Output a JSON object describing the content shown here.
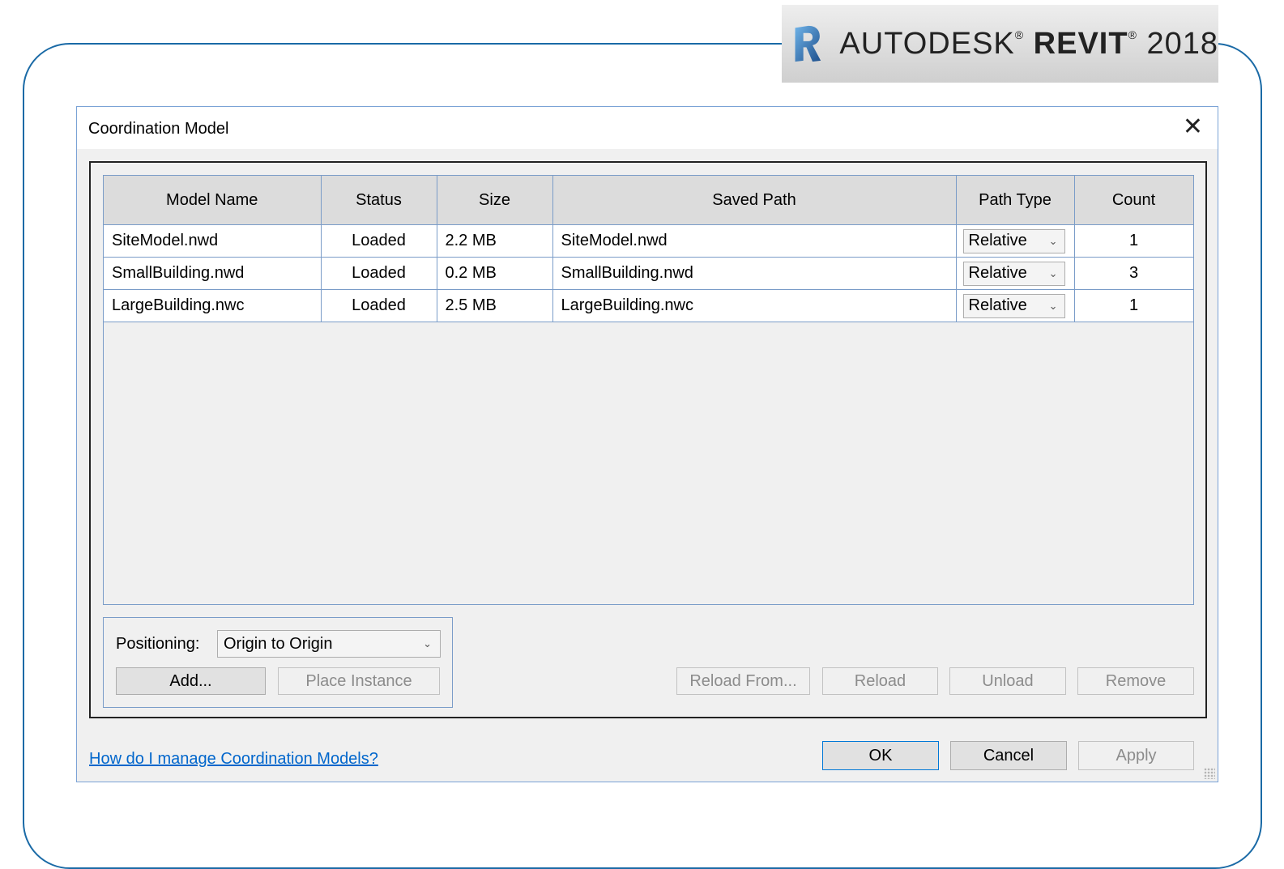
{
  "brand": {
    "logo_letter": "R",
    "name_light": "AUTODESK",
    "name_bold": "REVIT",
    "mark": "®",
    "year": "2018"
  },
  "dialog": {
    "title": "Coordination Model",
    "close_glyph": "✕"
  },
  "table": {
    "headers": [
      "Model Name",
      "Status",
      "Size",
      "Saved Path",
      "Path Type",
      "Count"
    ],
    "rows": [
      {
        "name": "SiteModel.nwd",
        "status": "Loaded",
        "size": "2.2 MB",
        "path": "SiteModel.nwd",
        "path_type": "Relative",
        "count": "1"
      },
      {
        "name": "SmallBuilding.nwd",
        "status": "Loaded",
        "size": "0.2 MB",
        "path": "SmallBuilding.nwd",
        "path_type": "Relative",
        "count": "3"
      },
      {
        "name": "LargeBuilding.nwc",
        "status": "Loaded",
        "size": "2.5 MB",
        "path": "LargeBuilding.nwc",
        "path_type": "Relative",
        "count": "1"
      }
    ]
  },
  "positioning": {
    "label": "Positioning:",
    "value": "Origin to Origin"
  },
  "buttons": {
    "add": "Add...",
    "place_instance": "Place Instance",
    "reload_from": "Reload From...",
    "reload": "Reload",
    "unload": "Unload",
    "remove": "Remove",
    "ok": "OK",
    "cancel": "Cancel",
    "apply": "Apply"
  },
  "help_link": "How do I manage Coordination Models?",
  "icons": {
    "dropdown": "chevron-down-icon",
    "close": "close-icon",
    "logo": "revit-logo-icon"
  },
  "colors": {
    "frame": "#1a6aa6",
    "dialog_border": "#7ba3d6",
    "link": "#0066cc",
    "header_bg": "#dcdcdc",
    "disabled_text": "#8c8c8c"
  }
}
